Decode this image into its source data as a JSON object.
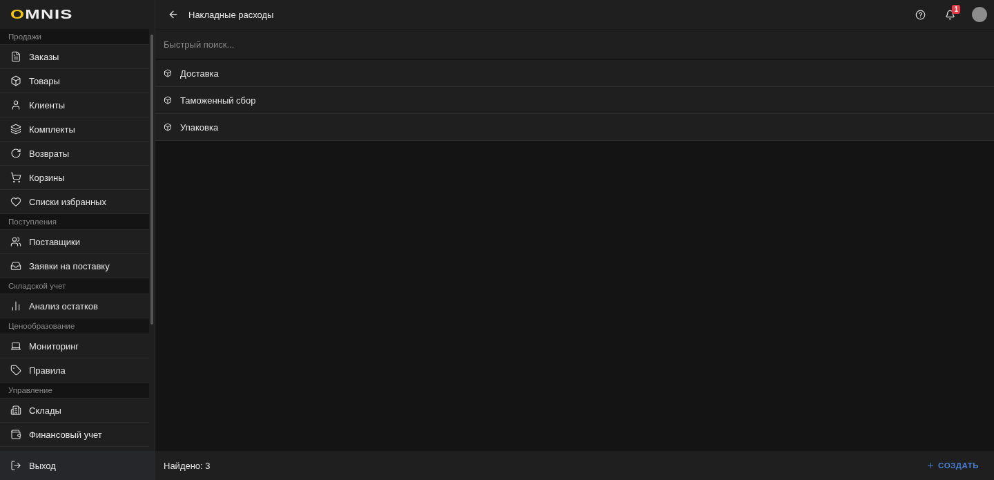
{
  "logo": "OMNIS",
  "sidebar": {
    "sections": [
      {
        "title": "Продажи",
        "items": [
          {
            "label": "Заказы"
          },
          {
            "label": "Товары"
          },
          {
            "label": "Клиенты"
          },
          {
            "label": "Комплекты"
          },
          {
            "label": "Возвраты"
          },
          {
            "label": "Корзины"
          },
          {
            "label": "Списки избранных"
          }
        ]
      },
      {
        "title": "Поступления",
        "items": [
          {
            "label": "Поставщики"
          },
          {
            "label": "Заявки на поставку"
          }
        ]
      },
      {
        "title": "Складской учет",
        "items": [
          {
            "label": "Анализ остатков"
          }
        ]
      },
      {
        "title": "Ценообразование",
        "items": [
          {
            "label": "Мониторинг"
          },
          {
            "label": "Правила"
          }
        ]
      },
      {
        "title": "Управление",
        "items": [
          {
            "label": "Склады"
          },
          {
            "label": "Финансовый учет"
          }
        ]
      }
    ],
    "logout": "Выход"
  },
  "header": {
    "title": "Накладные расходы",
    "notifications": "1"
  },
  "search": {
    "placeholder": "Быстрый поиск..."
  },
  "rows": [
    {
      "label": "Доставка"
    },
    {
      "label": "Таможенный сбор"
    },
    {
      "label": "Упаковка"
    }
  ],
  "footer": {
    "count": "Найдено: 3",
    "create": "СОЗДАТЬ"
  }
}
